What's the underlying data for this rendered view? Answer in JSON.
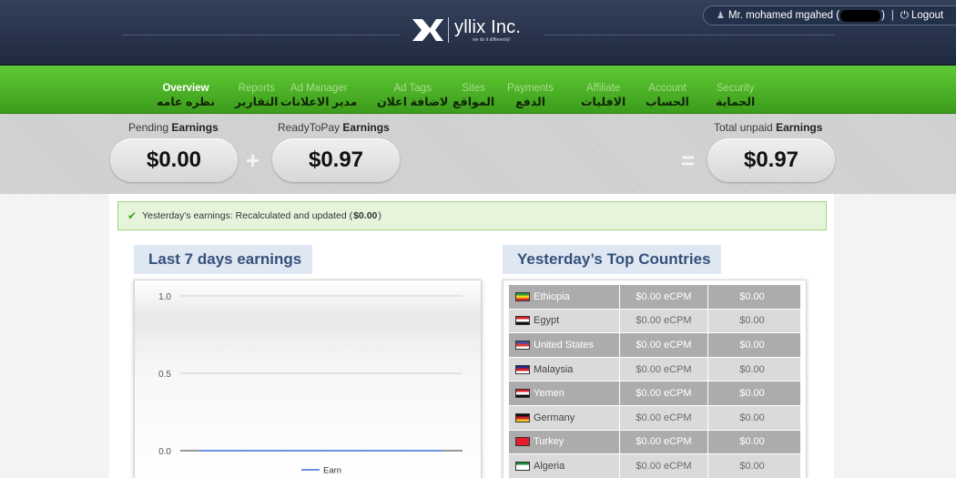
{
  "header": {
    "logo_text": "yllix Inc.",
    "logo_tagline": "we do it differently!",
    "user_name": "Mr. mohamed mgahed (",
    "user_close": ")",
    "logout_label": "Logout"
  },
  "nav": [
    {
      "en": "Overview",
      "ar": "نظره عامه",
      "active": true
    },
    {
      "en": "Reports",
      "ar": "التقارير"
    },
    {
      "en": "Ad Manager",
      "ar": "مدير الاعلانات"
    },
    {
      "en": "Ad Tags",
      "ar": "لاضافة اعلان"
    },
    {
      "en": "Sites",
      "ar": "المواقع"
    },
    {
      "en": "Payments",
      "ar": "الدفع"
    },
    {
      "en": "Affiliate",
      "ar": "الافليات"
    },
    {
      "en": "Account",
      "ar": "الحساب"
    },
    {
      "en": "Security",
      "ar": "الحماية"
    }
  ],
  "earnings": {
    "pending_label": "Pending",
    "ready_label": "ReadyToPay",
    "total_label": "Total unpaid",
    "earnings_word": "Earnings",
    "pending_value": "$0.00",
    "ready_value": "$0.97",
    "total_value": "$0.97",
    "plus": "+",
    "equals": "="
  },
  "alert": {
    "text": "Yesterday's earnings: Recalculated and updated (",
    "amount": "$0.00",
    "close": ")"
  },
  "last7": {
    "title": "Last 7 days earnings"
  },
  "chart_data": {
    "type": "line",
    "title": "Last 7 days earnings",
    "y_ticks": [
      "1.0",
      "0.5",
      "0.0"
    ],
    "ylim": [
      0,
      1
    ],
    "series": [
      {
        "name": "Earn",
        "color": "#3e6fd6",
        "values": [
          0,
          0,
          0,
          0,
          0,
          0,
          0
        ]
      }
    ],
    "grid": true,
    "legend": "bottom"
  },
  "countries": {
    "title": "Yesterday’s Top Countries",
    "rows": [
      {
        "name": "Ethiopia",
        "ecpm": "$0.00 eCPM",
        "earn": "$0.00",
        "flag": [
          "#2a9a34",
          "#f3d21a",
          "#d82a26"
        ]
      },
      {
        "name": "Egypt",
        "ecpm": "$0.00 eCPM",
        "earn": "$0.00",
        "flag": [
          "#d61f26",
          "#ffffff",
          "#111111"
        ]
      },
      {
        "name": "United States",
        "ecpm": "$0.00 eCPM",
        "earn": "$0.00",
        "flag": [
          "#3a4fa8",
          "#d93a3a",
          "#ffffff"
        ]
      },
      {
        "name": "Malaysia",
        "ecpm": "$0.00 eCPM",
        "earn": "$0.00",
        "flag": [
          "#1b2e8a",
          "#d61f26",
          "#ffffff"
        ]
      },
      {
        "name": "Yemen",
        "ecpm": "$0.00 eCPM",
        "earn": "$0.00",
        "flag": [
          "#d61f26",
          "#ffffff",
          "#111111"
        ]
      },
      {
        "name": "Germany",
        "ecpm": "$0.00 eCPM",
        "earn": "$0.00",
        "flag": [
          "#111111",
          "#d61f26",
          "#f2c81a"
        ]
      },
      {
        "name": "Turkey",
        "ecpm": "$0.00 eCPM",
        "earn": "$0.00",
        "flag": [
          "#e31d2b",
          "#e31d2b",
          "#e31d2b"
        ]
      },
      {
        "name": "Algeria",
        "ecpm": "$0.00 eCPM",
        "earn": "$0.00",
        "flag": [
          "#1c8a3b",
          "#ffffff",
          "#ffffff"
        ]
      }
    ]
  }
}
